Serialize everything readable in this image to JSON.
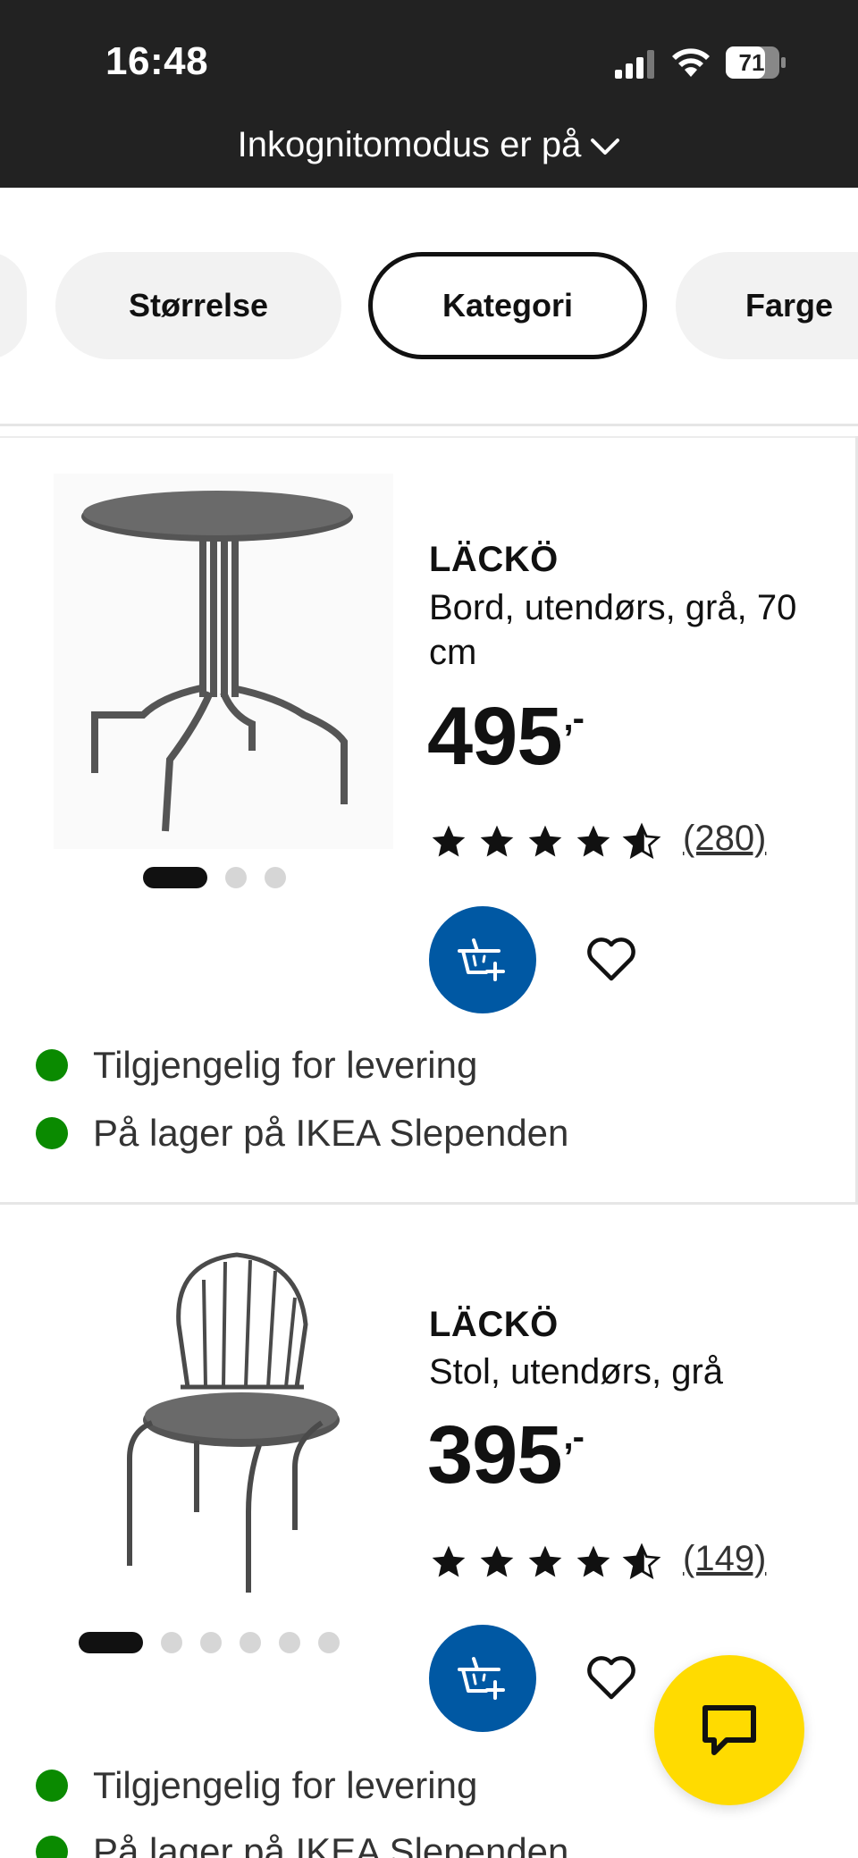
{
  "status_bar": {
    "time": "16:48",
    "battery": "71",
    "icons": [
      "signal-icon",
      "wifi-icon",
      "battery-icon"
    ],
    "incognito_label": "Inkognitomodus er på"
  },
  "filters": {
    "chips": [
      "Størrelse",
      "Kategori",
      "Farge"
    ],
    "selected": "Kategori"
  },
  "products": [
    {
      "brand": "LÄCKÖ",
      "description": "Bord, utendørs, grå, 70 cm",
      "price": "495",
      "price_suffix": ",-",
      "rating": 4.5,
      "reviews": "(280)",
      "image_count": 3,
      "availability": [
        "Tilgjengelig for levering",
        "På lager på IKEA Slependen"
      ]
    },
    {
      "brand": "LÄCKÖ",
      "description": "Stol, utendørs, grå",
      "price": "395",
      "price_suffix": ",-",
      "rating": 4.5,
      "reviews": "(149)",
      "image_count": 6,
      "availability": [
        "Tilgjengelig for levering",
        "På lager på IKEA Slependen"
      ]
    }
  ],
  "colors": {
    "status_bar_bg": "#222222",
    "cart_button": "#0058a3",
    "in_stock": "#0a8a00",
    "chat_fab": "#ffdb00"
  }
}
